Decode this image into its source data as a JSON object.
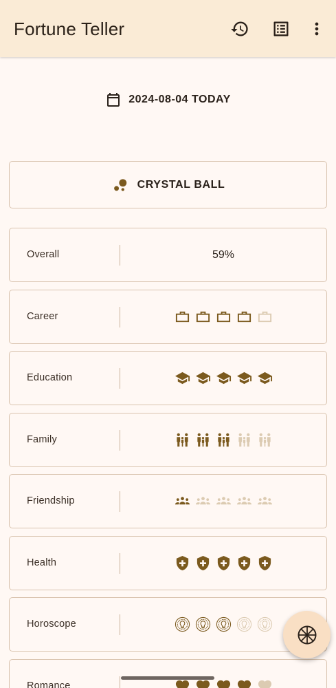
{
  "app": {
    "title": "Fortune Teller"
  },
  "appbar": {
    "actions": [
      "history-icon",
      "list-icon",
      "more-vert-icon"
    ]
  },
  "date": {
    "icon": "calendar-icon",
    "label": "2024-08-04 TODAY"
  },
  "crystal_ball": {
    "icon": "bubbles-icon",
    "label": "CRYSTAL BALL"
  },
  "colors": {
    "filled": "#7B5A1E",
    "empty": "#DCCBB2",
    "appbar": "#FAEBD6",
    "background": "#FFF8F4",
    "fab": "#F9DFC4"
  },
  "fortunes": [
    {
      "label": "Overall",
      "value": "59%"
    },
    {
      "label": "Career",
      "icon": "briefcase-icon",
      "rating": 4,
      "max": 5
    },
    {
      "label": "Education",
      "icon": "graduation-cap-icon",
      "rating": 5,
      "max": 5
    },
    {
      "label": "Family",
      "icon": "family-icon",
      "rating": 3,
      "max": 5
    },
    {
      "label": "Friendship",
      "icon": "group-icon",
      "rating": 1,
      "max": 5
    },
    {
      "label": "Health",
      "icon": "health-shield-icon",
      "rating": 5,
      "max": 5
    },
    {
      "label": "Horoscope",
      "icon": "zodiac-icon",
      "rating": 3,
      "max": 5
    },
    {
      "label": "Romance",
      "icon": "heart-icon",
      "rating": 4,
      "max": 5
    }
  ],
  "fab": {
    "icon": "wheel-icon"
  }
}
